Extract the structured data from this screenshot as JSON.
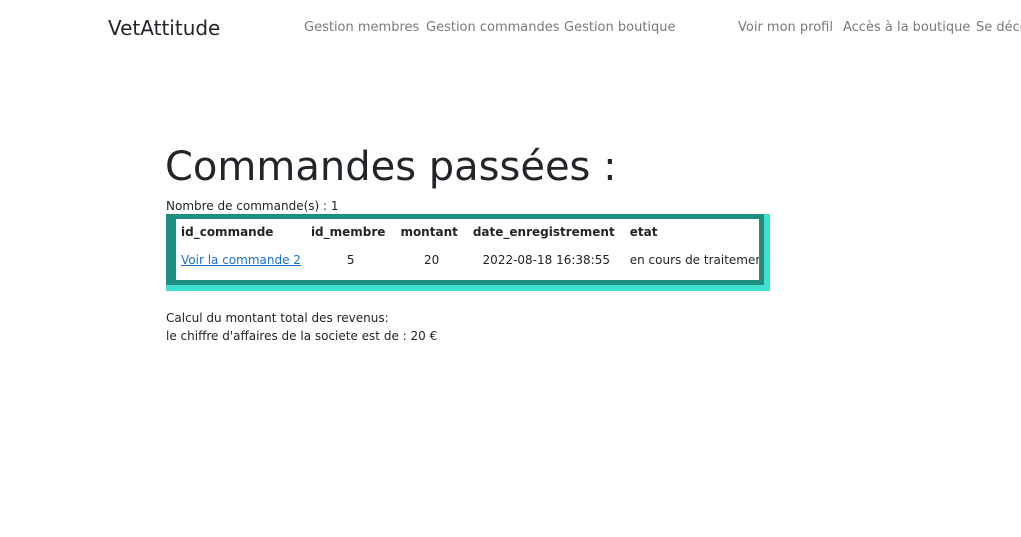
{
  "navbar": {
    "brand": "VetAttitude",
    "left_links": [
      "Gestion membres",
      "Gestion commandes",
      "Gestion boutique"
    ],
    "right_links": [
      "Voir mon profil",
      "Accès à la boutique",
      "Se déco"
    ]
  },
  "main": {
    "title": "Commandes passées :",
    "count_label": "Nombre de commande(s) : 1",
    "table": {
      "headers": [
        "id_commande",
        "id_membre",
        "montant",
        "date_enregistrement",
        "etat"
      ],
      "rows": [
        {
          "id_commande": "Voir la commande 2",
          "id_membre": "5",
          "montant": "20",
          "date_enregistrement": "2022-08-18 16:38:55",
          "etat": "en cours de traitement"
        }
      ]
    },
    "revenue_intro": "Calcul du montant total des revenus:",
    "revenue_line": "le chiffre d'affaires de la societe est de : 20 €"
  },
  "colors": {
    "frame_light": "#40e0d0",
    "frame_dark": "#1e8f7e",
    "link": "#1a6fd6"
  }
}
